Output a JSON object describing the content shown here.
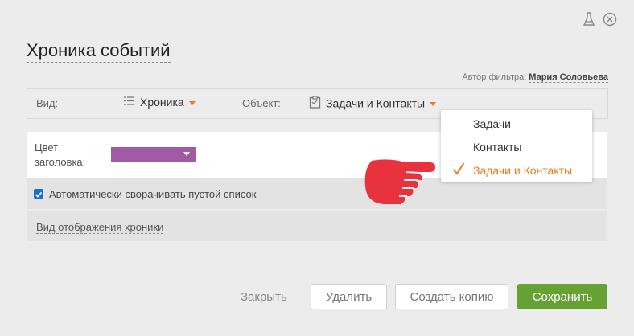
{
  "header": {
    "title": "Хроника событий",
    "author_label": "Автор фильтра:",
    "author_name": "Мария Соловьева"
  },
  "filter": {
    "view_label": "Вид:",
    "view_value": "Хроника",
    "object_label": "Объект:",
    "object_value": "Задачи и Контакты"
  },
  "dropdown": {
    "items": [
      "Задачи",
      "Контакты",
      "Задачи и Контакты"
    ],
    "selected": "Задачи и Контакты"
  },
  "settings": {
    "color_label": "Цвет заголовка:",
    "color_value": "#a05aa6",
    "autocollapse_label": "Автоматически сворачивать пустой список",
    "autocollapse_checked": true,
    "display_link": "Вид отображения хроники"
  },
  "footer": {
    "close": "Закрыть",
    "delete": "Удалить",
    "copy": "Создать копию",
    "save": "Сохранить"
  },
  "colors": {
    "accent": "#f07a1a",
    "save_button": "#65a233",
    "pointer": "#e8333f"
  }
}
